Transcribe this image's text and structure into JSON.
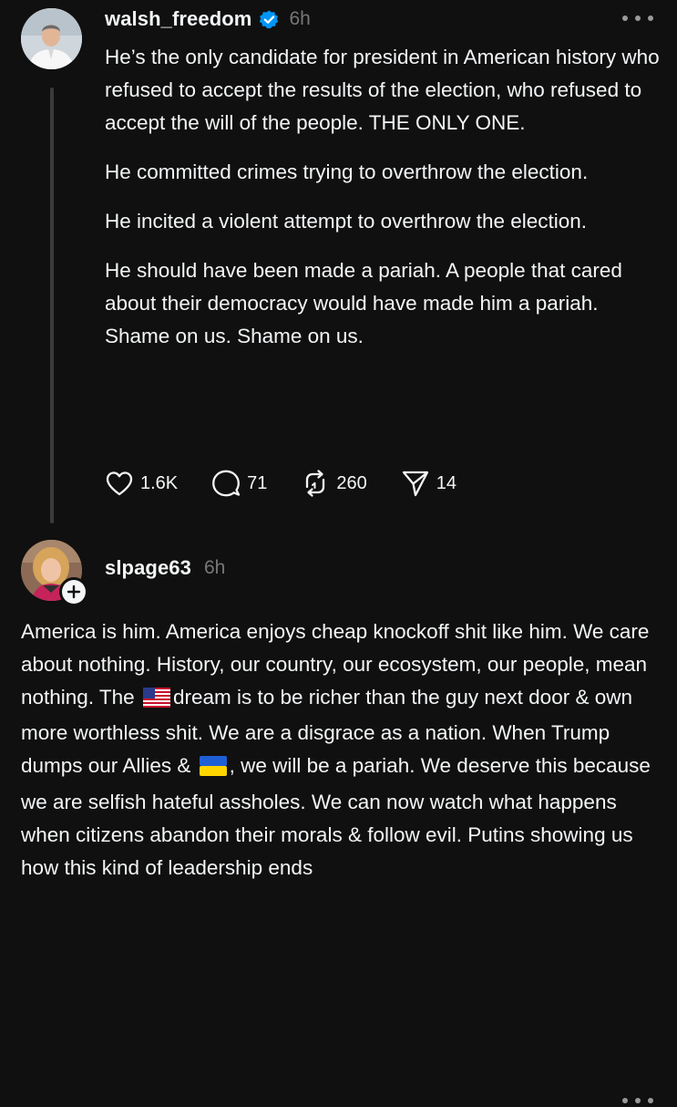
{
  "post": {
    "author": "walsh_freedom",
    "time": "6h",
    "paragraphs": [
      "He’s the only candidate for president in American history who refused to accept the results of the election, who refused to accept the will of the people. THE ONLY ONE.",
      "He committed crimes trying to overthrow the election.",
      "He incited a violent attempt to overthrow the election.",
      "He should have been made a pariah. A people that cared about their democracy would have made him a pariah. Shame on us. Shame on us."
    ],
    "actions": {
      "likes": "1.6K",
      "replies": "71",
      "reposts": "260",
      "shares": "14"
    },
    "icons": {
      "verified": "verified-badge-icon",
      "like": "heart-icon",
      "reply": "comment-icon",
      "repost": "repost-icon",
      "share": "send-icon",
      "more": "more-dots-icon"
    }
  },
  "reply": {
    "author": "slpage63",
    "time": "6h",
    "text_part1": "America is him. America enjoys cheap knockoff shit like him. We care about nothing. History, our country, our ecosystem, our people, mean nothing. The",
    "emoji_1": "us-flag-emoji",
    "text_part2": "dream is to be richer than the guy next door & own more worthless shit. We are a disgrace as a nation. When Trump dumps our Allies &",
    "emoji_2": "ukraine-flag-emoji",
    "text_part3": ", we will be a pariah. We deserve this because we are selfish hateful assholes. We can now watch what happens when citizens abandon their morals & follow evil. Putins showing us how this kind of leadership ends",
    "icons": {
      "follow": "plus-icon",
      "more": "more-dots-icon"
    }
  },
  "colors": {
    "background": "#101010",
    "text": "#f3f5f7",
    "muted": "#777777",
    "thread_line": "#3b3b3d",
    "verified": "#0095f6"
  }
}
